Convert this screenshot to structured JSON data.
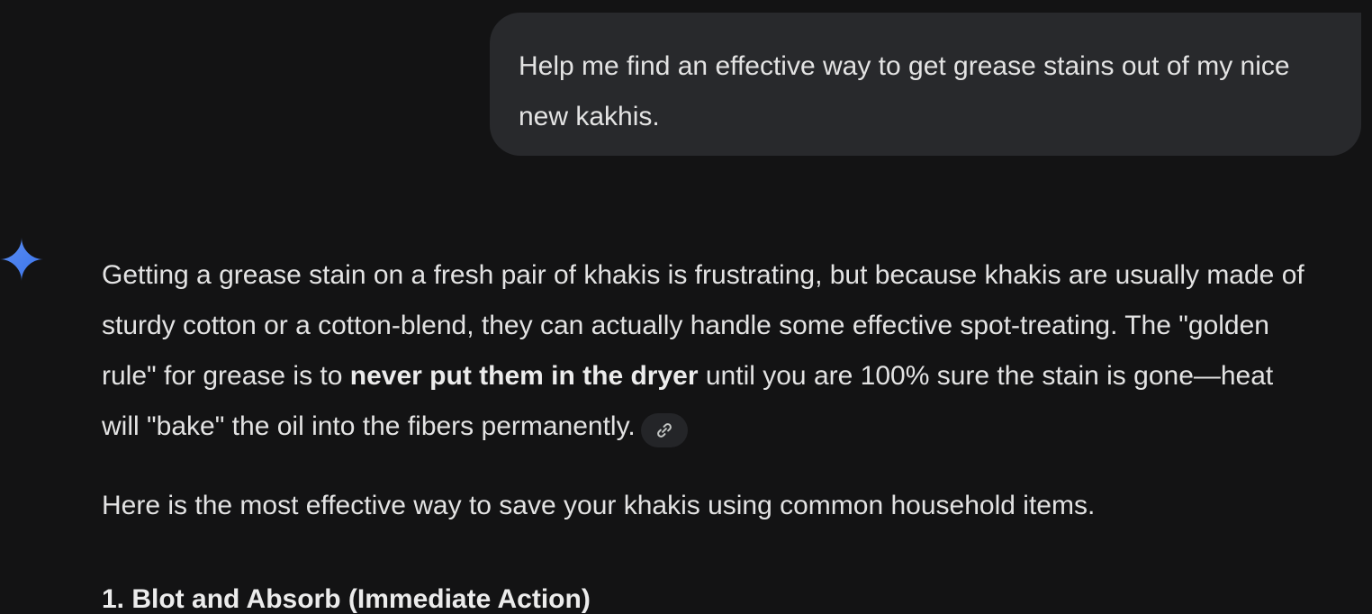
{
  "user_prompt": {
    "text": "Help me find an effective way to get grease stains out of my nice new kakhis."
  },
  "assistant": {
    "icon": "gemini-sparkle-icon",
    "accent_color": "#4f8ff7",
    "paragraph1": {
      "before_bold": "Getting a grease stain on a fresh pair of khakis is frustrating, but because khakis are usually made of sturdy cotton or a cotton-blend, they can actually handle some effective spot-treating. The \"golden rule\" for grease is to ",
      "bold": "never put them in the dryer",
      "after_bold": " until you are 100% sure the stain is gone—heat will \"bake\" the oil into the fibers permanently."
    },
    "source_chip_icon": "link-icon",
    "paragraph2": "Here is the most effective way to save your khakis using common household items.",
    "heading1": "1. Blot and Absorb (Immediate Action)"
  }
}
